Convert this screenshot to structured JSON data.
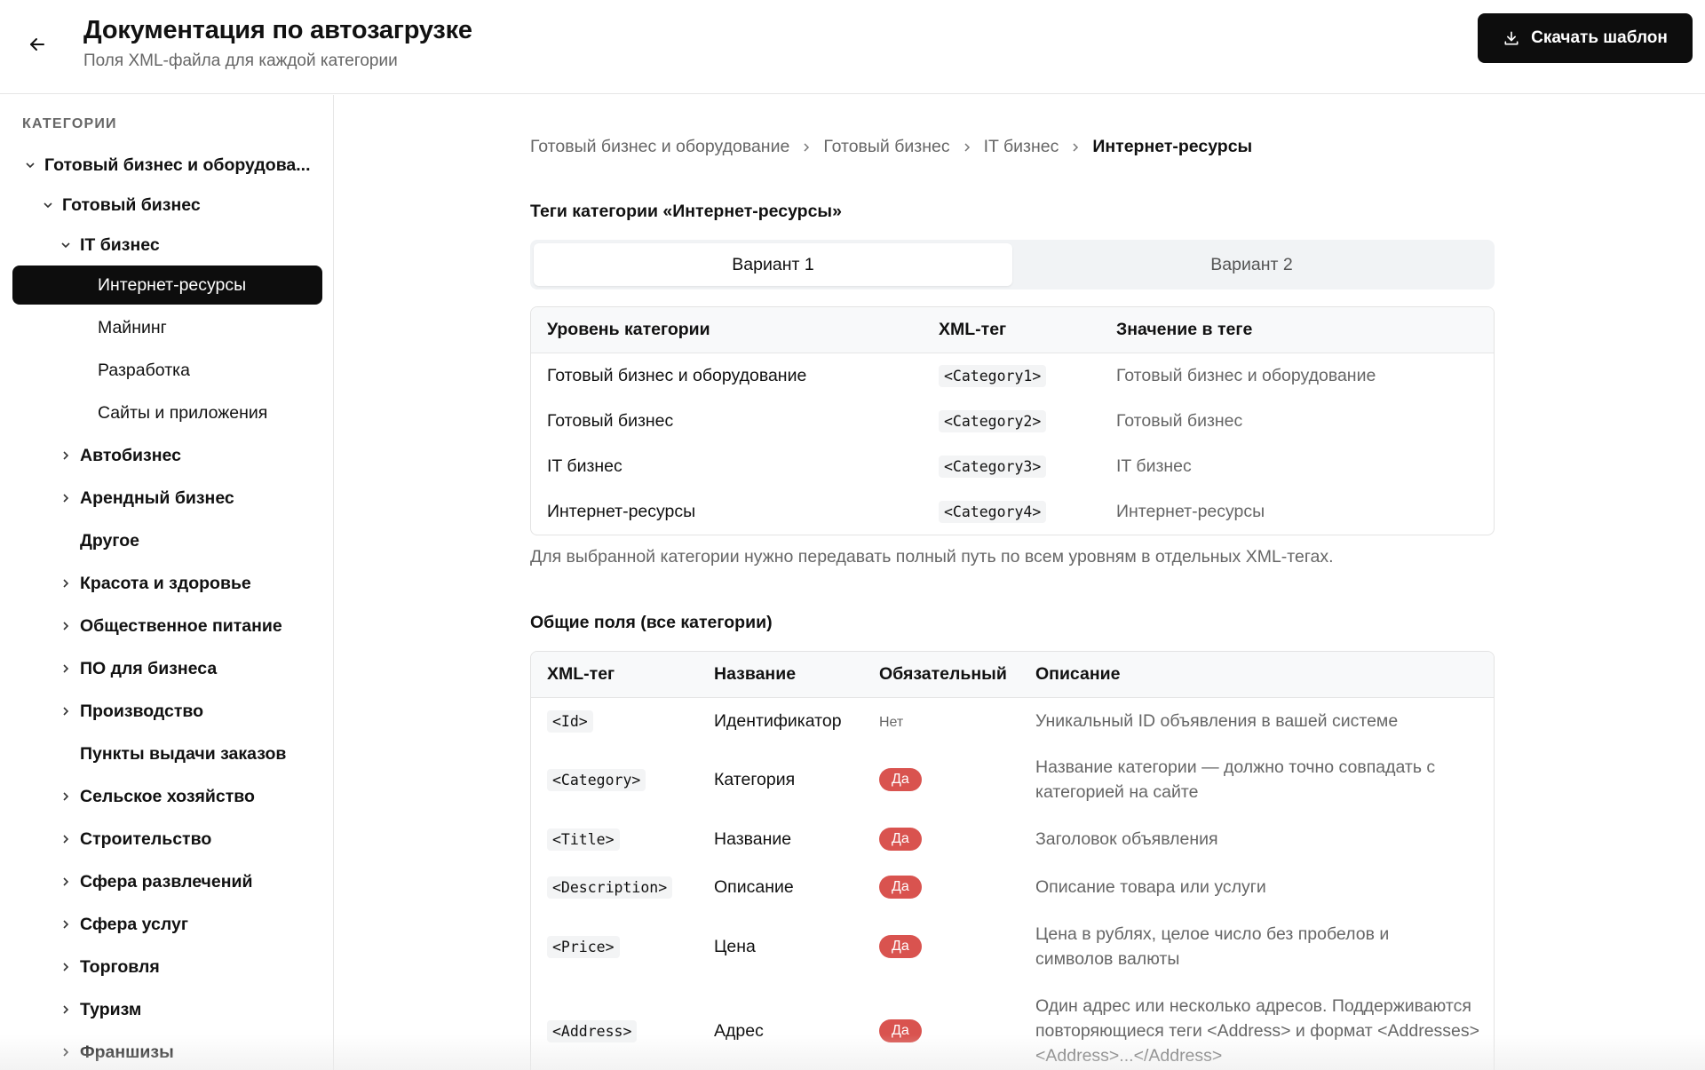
{
  "header": {
    "title": "Документация по автозагрузке",
    "subtitle": "Поля XML-файла для каждой категории",
    "download_label": "Скачать шаблон"
  },
  "sidebar": {
    "heading": "КАТЕГОРИИ",
    "items": [
      {
        "label": "Готовый бизнес и оборудова...",
        "chevron": "down"
      },
      {
        "label": "Готовый бизнес",
        "chevron": "down"
      },
      {
        "label": "IT бизнес",
        "chevron": "down"
      },
      {
        "label": "Интернет-ресурсы",
        "active": true
      },
      {
        "label": "Майнинг"
      },
      {
        "label": "Разработка"
      },
      {
        "label": "Сайты и приложения"
      },
      {
        "label": "Автобизнес",
        "chevron": "right"
      },
      {
        "label": "Арендный бизнес",
        "chevron": "right"
      },
      {
        "label": "Другое"
      },
      {
        "label": "Красота и здоровье",
        "chevron": "right"
      },
      {
        "label": "Общественное питание",
        "chevron": "right"
      },
      {
        "label": "ПО для бизнеса",
        "chevron": "right"
      },
      {
        "label": "Производство",
        "chevron": "right"
      },
      {
        "label": "Пункты выдачи заказов"
      },
      {
        "label": "Сельское хозяйство",
        "chevron": "right"
      },
      {
        "label": "Строительство",
        "chevron": "right"
      },
      {
        "label": "Сфера развлечений",
        "chevron": "right"
      },
      {
        "label": "Сфера услуг",
        "chevron": "right"
      },
      {
        "label": "Торговля",
        "chevron": "right"
      },
      {
        "label": "Туризм",
        "chevron": "right"
      },
      {
        "label": "Франшизы",
        "chevron": "right"
      }
    ]
  },
  "breadcrumb": [
    "Готовый бизнес и оборудование",
    "Готовый бизнес",
    "IT бизнес",
    "Интернет-ресурсы"
  ],
  "category_tags": {
    "title": "Теги категории «Интернет-ресурсы»",
    "tabs": [
      "Вариант 1",
      "Вариант 2"
    ],
    "active_tab": 0,
    "columns": [
      "Уровень категории",
      "XML-тег",
      "Значение в теге"
    ],
    "rows": [
      [
        "Готовый бизнес и оборудование",
        "<Category1>",
        "Готовый бизнес и оборудование"
      ],
      [
        "Готовый бизнес",
        "<Category2>",
        "Готовый бизнес"
      ],
      [
        "IT бизнес",
        "<Category3>",
        "IT бизнес"
      ],
      [
        "Интернет-ресурсы",
        "<Category4>",
        "Интернет-ресурсы"
      ]
    ],
    "note": "Для выбранной категории нужно передавать полный путь по всем уровням в отдельных XML-тегах."
  },
  "common_fields": {
    "title": "Общие поля (все категории)",
    "columns": [
      "XML-тег",
      "Название",
      "Обязательный",
      "Описание"
    ],
    "rows": [
      {
        "tag": "<Id>",
        "name": "Идентификатор",
        "required": "Нет",
        "required_flag": false,
        "desc": "Уникальный ID объявления в вашей системе"
      },
      {
        "tag": "<Category>",
        "name": "Категория",
        "required": "Да",
        "required_flag": true,
        "desc": "Название категории — должно точно совпадать с категорией на сайте"
      },
      {
        "tag": "<Title>",
        "name": "Название",
        "required": "Да",
        "required_flag": true,
        "desc": "Заголовок объявления"
      },
      {
        "tag": "<Description>",
        "name": "Описание",
        "required": "Да",
        "required_flag": true,
        "desc": "Описание товара или услуги"
      },
      {
        "tag": "<Price>",
        "name": "Цена",
        "required": "Да",
        "required_flag": true,
        "desc": "Цена в рублях, целое число без пробелов и символов валюты"
      },
      {
        "tag": "<Address>",
        "name": "Адрес",
        "required": "Да",
        "required_flag": true,
        "desc": "Один адрес или несколько адресов. Поддерживаются повторяющиеся теги <Address> и формат <Addresses><Address>...</Address>"
      }
    ]
  },
  "colors": {
    "primary_dark": "#0d0d0d",
    "required_badge": "#d9534f",
    "muted_text": "#666666"
  },
  "icons": {
    "back": "arrow-left-icon",
    "download": "download-icon",
    "expand": "chevron-down-icon",
    "collapsed": "chevron-right-icon",
    "separator": "chevron-right-icon"
  }
}
